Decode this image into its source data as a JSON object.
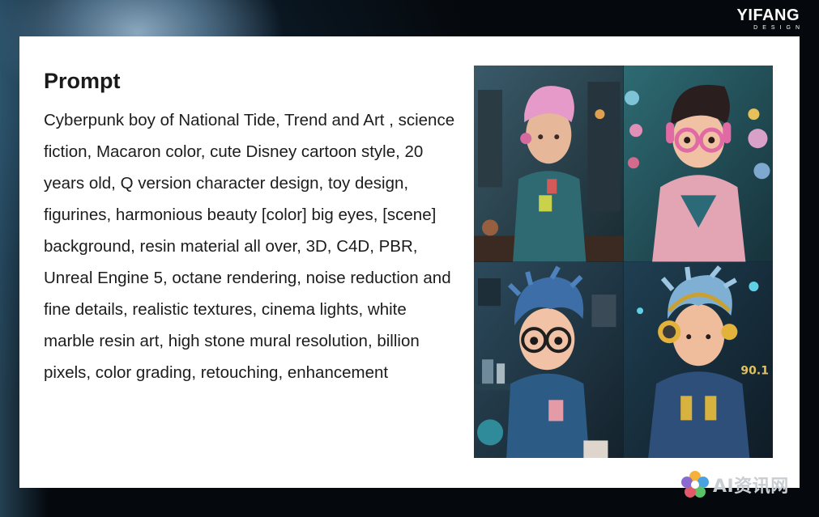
{
  "brand": {
    "name": "YIFANG",
    "sub": "DESIGN"
  },
  "card": {
    "title": "Prompt",
    "text": "Cyberpunk boy of National Tide, Trend and Art , science fiction, Macaron color, cute Disney cartoon style, 20 years old, Q version character design, toy design, figurines, harmonious beauty [color] big eyes, [scene] background, resin material all over, 3D, C4D, PBR, Unreal Engine 5, octane rendering, noise reduction and fine details, realistic textures, cinema lights, white marble resin art, high stone mural resolution, billion pixels, color grading, retouching, enhancement"
  },
  "images": [
    {
      "label": "pink-haired boy with teal jacket"
    },
    {
      "label": "boy with pink goggles and pink jacket"
    },
    {
      "label": "blue-haired boy with round glasses"
    },
    {
      "label": "boy with yellow headphones, sign 90.1",
      "sign": "90.1"
    }
  ],
  "watermark": {
    "text": "AI资讯网"
  }
}
